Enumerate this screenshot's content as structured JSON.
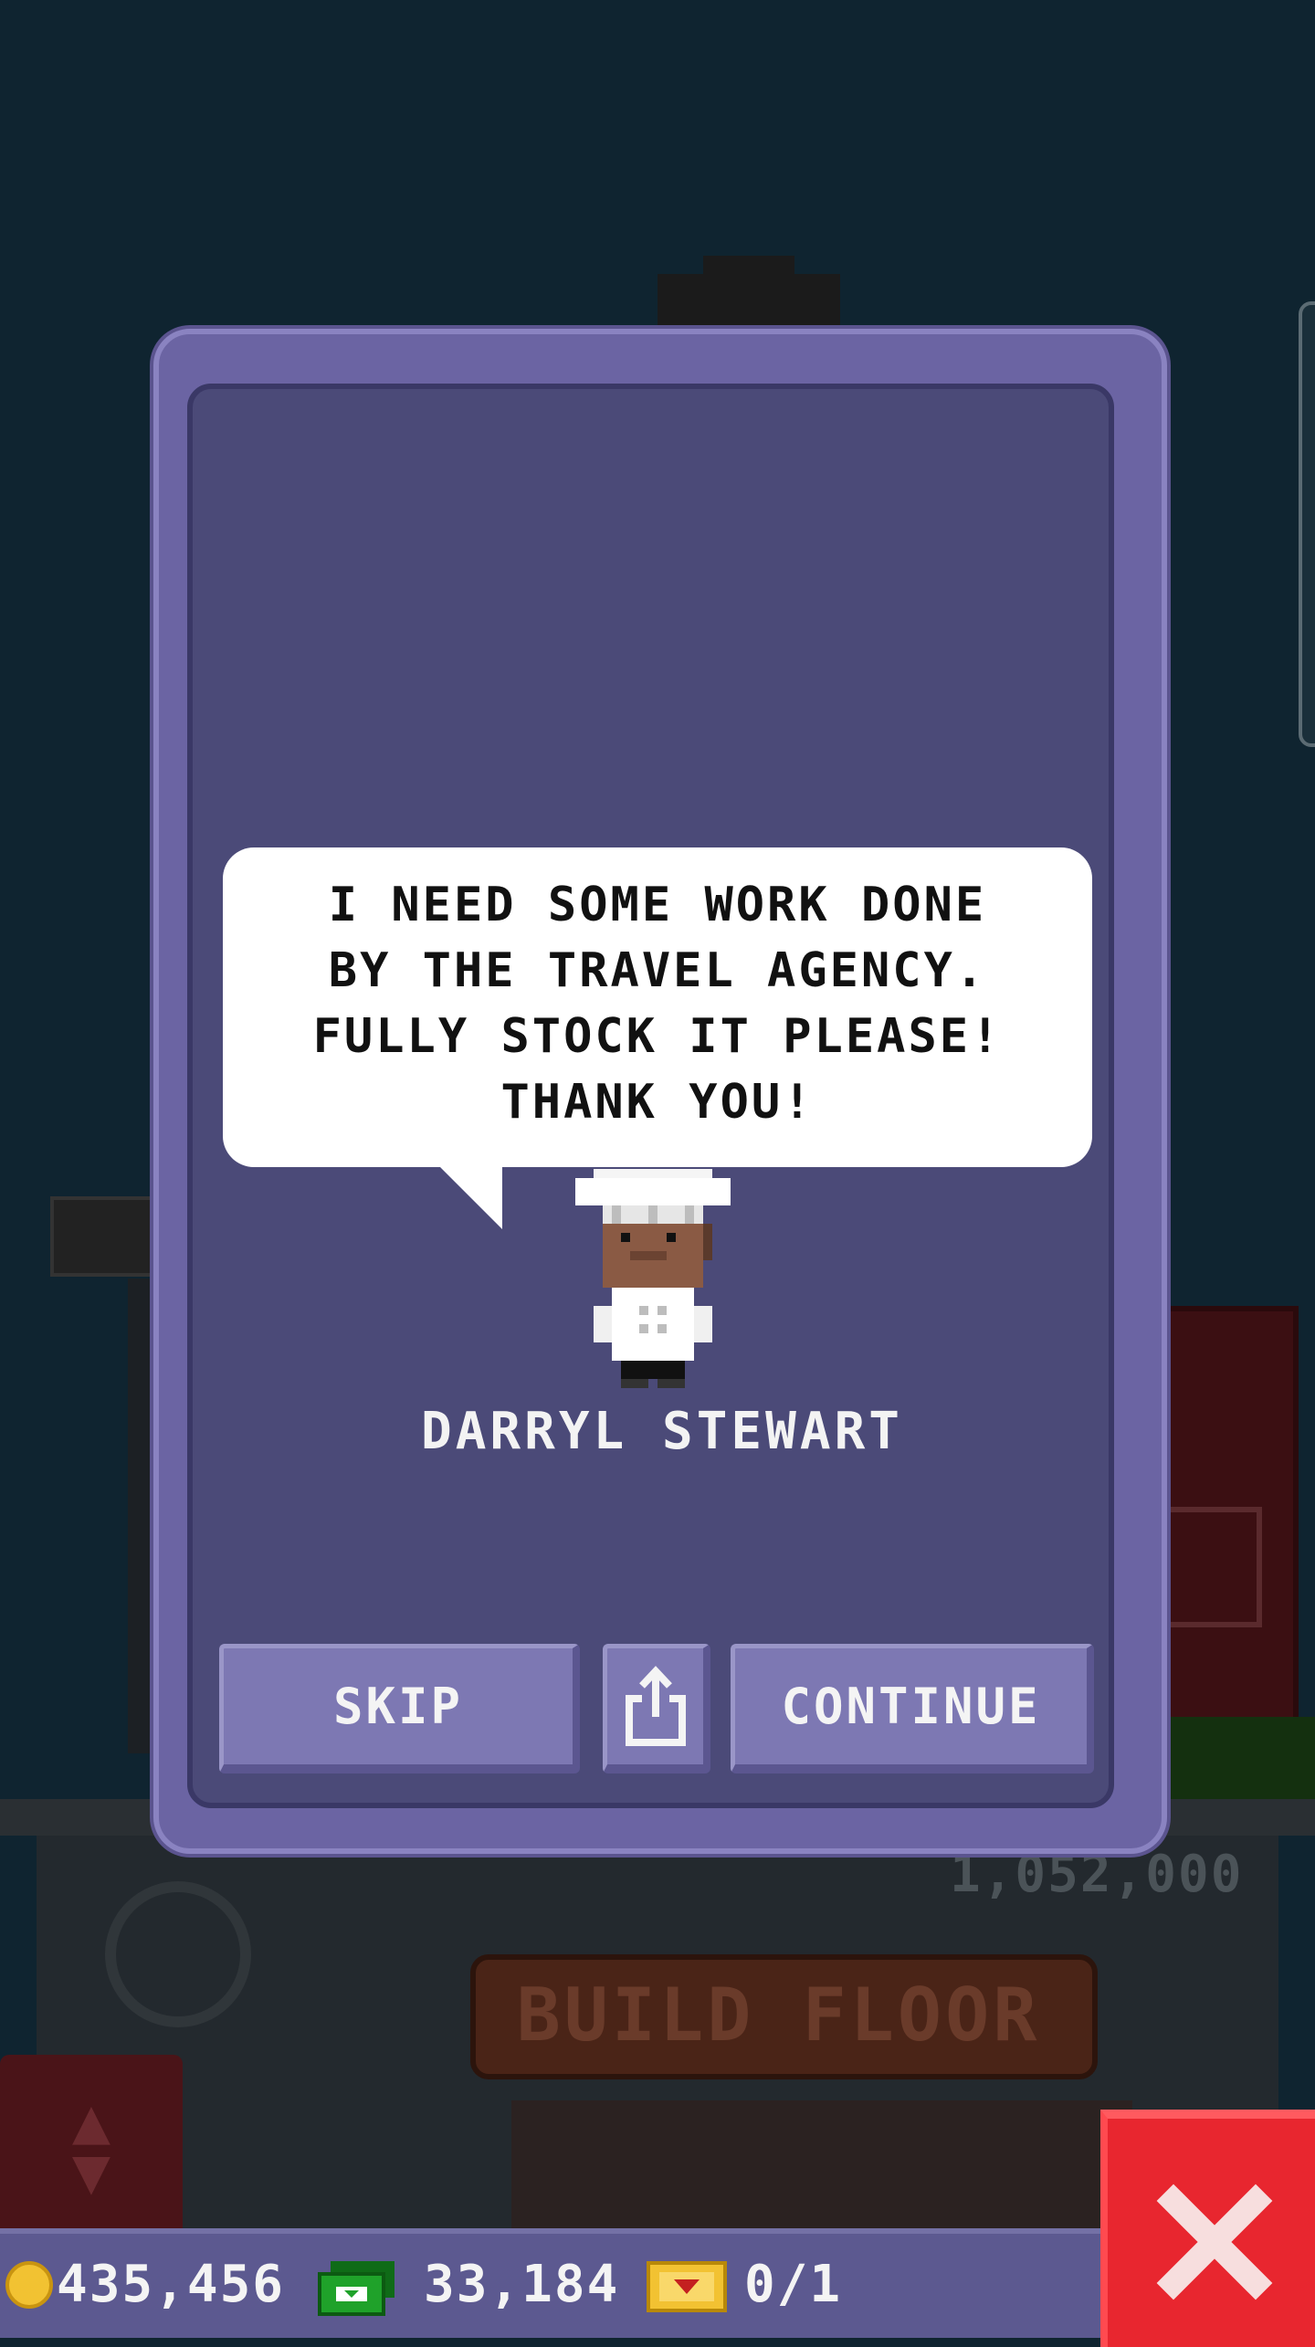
{
  "background": {
    "build_price": "1,052,000",
    "build_floor_label": "BUILD FLOOR"
  },
  "dialog": {
    "message": "I NEED SOME WORK DONE\nBY THE TRAVEL AGENCY.\nFULLY STOCK IT PLEASE!\nTHANK YOU!",
    "character_name": "DARRYL STEWART",
    "buttons": {
      "skip": "SKIP",
      "share_icon": "share-icon",
      "continue": "CONTINUE"
    }
  },
  "resources": {
    "coins": "435,456",
    "tower_bux": "33,184",
    "vip": "0/1"
  },
  "colors": {
    "panel": "#6b64a3",
    "panel_inner": "#4b4a78",
    "button": "#7d78b3",
    "close": "#e8262f",
    "coin": "#f2c232",
    "bux": "#1fa22a",
    "ticket": "#f2c232"
  }
}
